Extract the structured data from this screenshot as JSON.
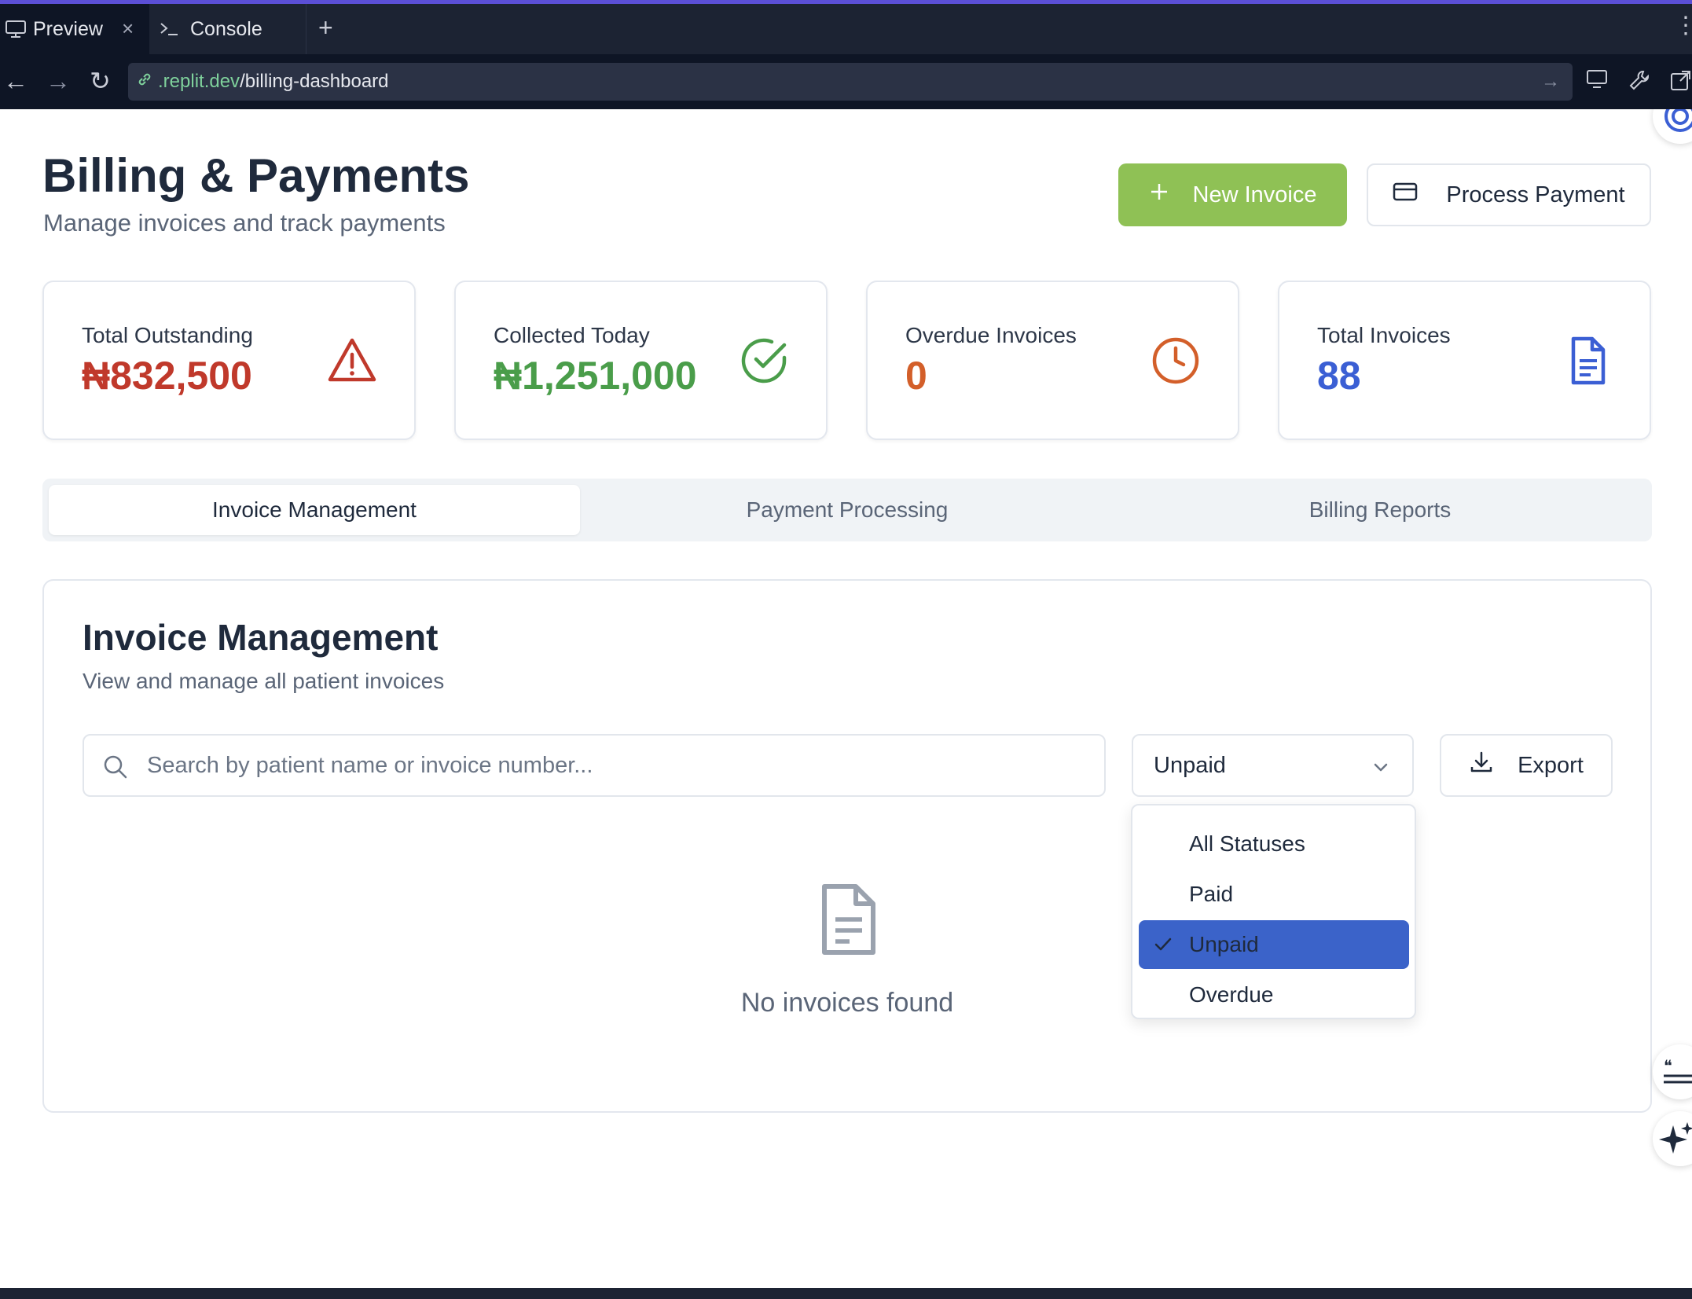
{
  "browser": {
    "tabs": [
      {
        "label": "Preview"
      },
      {
        "label": "Console"
      }
    ],
    "url_host": ".replit.dev",
    "url_path": "/billing-dashboard"
  },
  "header": {
    "title": "Billing & Payments",
    "subtitle": "Manage invoices and track payments",
    "new_invoice_label": "New Invoice",
    "process_payment_label": "Process Payment"
  },
  "stats": [
    {
      "label": "Total Outstanding",
      "value": "₦832,500",
      "color": "#c0392b",
      "icon": "alert-triangle-icon"
    },
    {
      "label": "Collected Today",
      "value": "₦1,251,000",
      "color": "#4a9d4a",
      "icon": "check-circle-icon"
    },
    {
      "label": "Overdue Invoices",
      "value": "0",
      "color": "#d35f2a",
      "icon": "clock-icon"
    },
    {
      "label": "Total Invoices",
      "value": "88",
      "color": "#3b5fd4",
      "icon": "document-icon"
    }
  ],
  "tabs": [
    {
      "label": "Invoice Management",
      "active": true
    },
    {
      "label": "Payment Processing",
      "active": false
    },
    {
      "label": "Billing Reports",
      "active": false
    }
  ],
  "panel": {
    "title": "Invoice Management",
    "subtitle": "View and manage all patient invoices",
    "search_placeholder": "Search by patient name or invoice number...",
    "status_selected": "Unpaid",
    "export_label": "Export",
    "empty_text": "No invoices found"
  },
  "status_options": [
    {
      "label": "All Statuses",
      "selected": false
    },
    {
      "label": "Paid",
      "selected": false
    },
    {
      "label": "Unpaid",
      "selected": true
    },
    {
      "label": "Overdue",
      "selected": false
    }
  ]
}
